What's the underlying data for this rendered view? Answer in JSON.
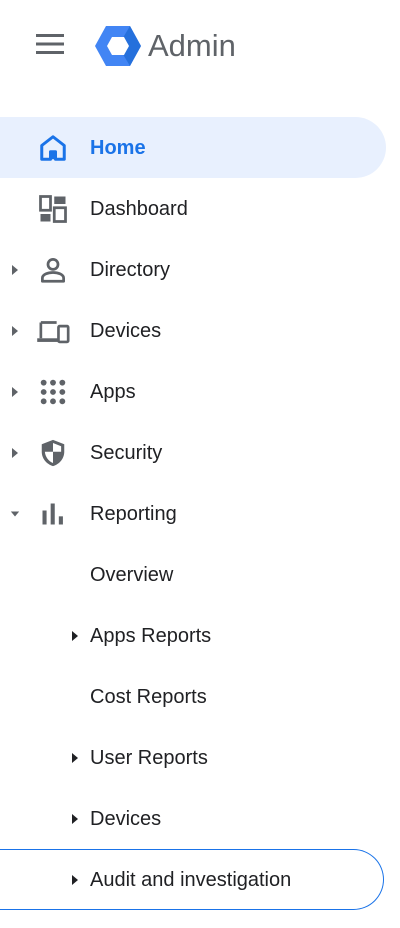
{
  "header": {
    "menu_icon": "menu-icon",
    "logo_icon": "admin-logo-icon",
    "title": "Admin"
  },
  "colors": {
    "accent": "#1a73e8",
    "active_bg": "#e8f0fe",
    "icon_gray": "#5f6368"
  },
  "nav": {
    "items": [
      {
        "label": "Home",
        "icon": "home-icon",
        "active": true
      },
      {
        "label": "Dashboard",
        "icon": "dashboard-icon"
      },
      {
        "label": "Directory",
        "icon": "person-icon",
        "expandable": true
      },
      {
        "label": "Devices",
        "icon": "devices-icon",
        "expandable": true
      },
      {
        "label": "Apps",
        "icon": "apps-grid-icon",
        "expandable": true
      },
      {
        "label": "Security",
        "icon": "shield-icon",
        "expandable": true
      },
      {
        "label": "Reporting",
        "icon": "bar-chart-icon",
        "expanded": true
      }
    ],
    "reporting_children": [
      {
        "label": "Overview"
      },
      {
        "label": "Apps Reports",
        "expandable": true
      },
      {
        "label": "Cost Reports"
      },
      {
        "label": "User Reports",
        "expandable": true
      },
      {
        "label": "Devices",
        "expandable": true
      },
      {
        "label": "Audit and investigation",
        "expandable": true,
        "focused": true
      }
    ]
  }
}
